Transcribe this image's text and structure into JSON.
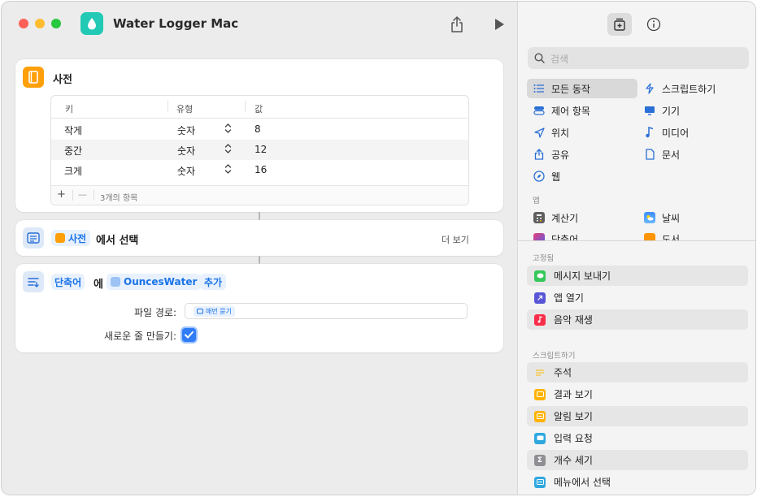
{
  "window": {
    "title": "Water Logger Mac"
  },
  "actions": {
    "dictionary": {
      "title": "사전",
      "columns": [
        "키",
        "유형",
        "값"
      ],
      "rows": [
        {
          "key": "작게",
          "type": "숫자",
          "value": "8"
        },
        {
          "key": "중간",
          "type": "숫자",
          "value": "12"
        },
        {
          "key": "크게",
          "type": "숫자",
          "value": "16"
        }
      ],
      "add_label": "+",
      "remove_label": "—",
      "count_label": "3개의 항목"
    },
    "choose": {
      "token": "사전",
      "text": "에서 선택",
      "more_label": "더 보기"
    },
    "append": {
      "token1": "단축어",
      "text1": "에",
      "token2": "OuncesWater",
      "token3": "추가",
      "path_label": "파일 경로:",
      "path_token": "매번 묻기",
      "newline_label": "새로운 줄 만들기:",
      "newline_checked": true
    }
  },
  "sidebar": {
    "search_placeholder": "검색",
    "categories": [
      {
        "label": "모든 동작",
        "icon": "list-icon",
        "selected": true
      },
      {
        "label": "스크립트하기",
        "icon": "script-icon"
      },
      {
        "label": "제어 항목",
        "icon": "toggle-icon"
      },
      {
        "label": "기기",
        "icon": "display-icon"
      },
      {
        "label": "위치",
        "icon": "location-icon"
      },
      {
        "label": "미디어",
        "icon": "music-note-icon"
      },
      {
        "label": "공유",
        "icon": "share-icon"
      },
      {
        "label": "문서",
        "icon": "document-icon"
      },
      {
        "label": "웹",
        "icon": "compass-icon"
      }
    ],
    "apps_label": "앱",
    "apps": [
      {
        "label": "계산기",
        "icon": "calculator-icon"
      },
      {
        "label": "날씨",
        "icon": "weather-icon"
      },
      {
        "label": "단축어",
        "icon": "shortcuts-icon"
      },
      {
        "label": "도서",
        "icon": "books-icon"
      }
    ],
    "pinned_label": "고정됨",
    "pinned": [
      {
        "label": "메시지 보내기",
        "icon": "messages-icon",
        "color": "#34c759"
      },
      {
        "label": "앱 열기",
        "icon": "open-app-icon",
        "color": "#5856d6"
      },
      {
        "label": "음악 재생",
        "icon": "music-icon",
        "color": "#fa2d48"
      }
    ],
    "scripting_label": "스크립트하기",
    "scripting": [
      {
        "label": "주석",
        "icon": "comment-icon",
        "color": "#f7c948"
      },
      {
        "label": "결과 보기",
        "icon": "show-result-icon",
        "color": "#ffb300"
      },
      {
        "label": "알림 보기",
        "icon": "alert-icon",
        "color": "#ffb300"
      },
      {
        "label": "입력 요청",
        "icon": "ask-input-icon",
        "color": "#2fa8e0"
      },
      {
        "label": "개수 세기",
        "icon": "count-icon",
        "color": "#8e8e93"
      },
      {
        "label": "메뉴에서 선택",
        "icon": "menu-icon",
        "color": "#2fa8e0"
      }
    ]
  }
}
